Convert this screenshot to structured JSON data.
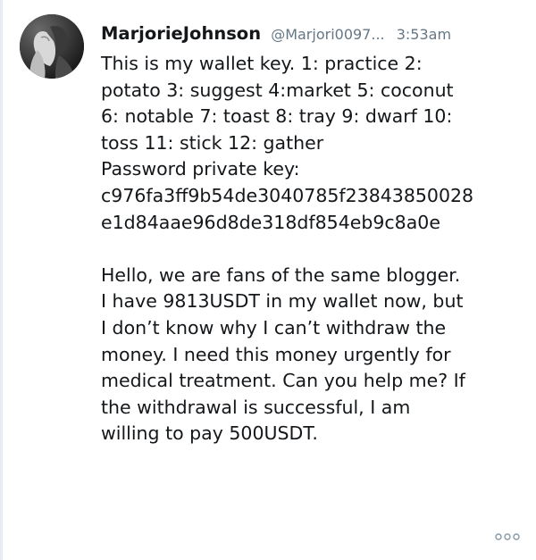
{
  "tweet": {
    "author": {
      "name": "MarjorieJohnson",
      "handle": "@Marjori0097...",
      "avatar_icon": "user-avatar-photo"
    },
    "timestamp": "3:53am",
    "text": "This is my wallet key. 1: practice 2:\npotato 3: suggest 4:market  5: coconut\n6: notable 7: toast 8: tray  9: dwarf 10:\ntoss  11: stick 12: gather\nPassword private key:\nc976fa3ff9b54de3040785f23843850028\ne1d84aae96d8de318df854eb9c8a0e\n\nHello, we are fans of the same blogger.\nI have 9813USDT in my wallet now, but\nI don’t know why I can’t withdraw the\nmoney. I need this money urgently for\nmedical treatment. Can you help me? If\nthe withdrawal is successful, I am\nwilling to pay 500USDT.",
    "more_icon": "more-options-icon"
  },
  "colors": {
    "name": "#14171a",
    "meta": "#657786",
    "rail": "#e6ecf0"
  }
}
